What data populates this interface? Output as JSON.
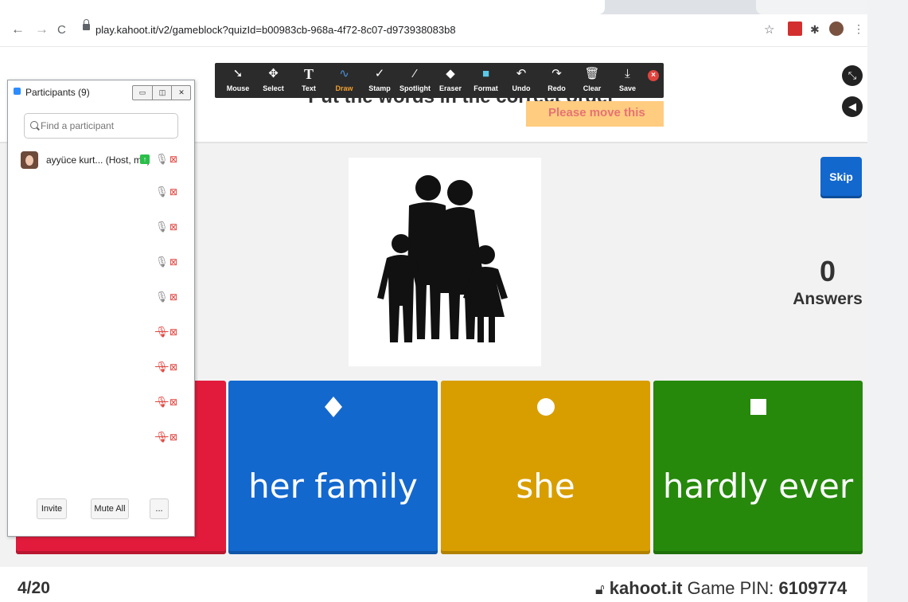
{
  "browser": {
    "url": "play.kahoot.it/v2/gameblock?quizId=b00983cb-968a-4f72-8c07-d973938083b8"
  },
  "annotation_toolbar": {
    "tools": [
      {
        "label": "Mouse",
        "icon": "cursor-arrow-icon"
      },
      {
        "label": "Select",
        "icon": "move-arrows-icon"
      },
      {
        "label": "Text",
        "icon": "text-t-icon"
      },
      {
        "label": "Draw",
        "icon": "squiggle-icon"
      },
      {
        "label": "Stamp",
        "icon": "checkmark-icon"
      },
      {
        "label": "Spotlight",
        "icon": "magic-wand-icon"
      },
      {
        "label": "Eraser",
        "icon": "eraser-icon"
      },
      {
        "label": "Format",
        "icon": "color-swatch-icon"
      },
      {
        "label": "Undo",
        "icon": "undo-icon"
      },
      {
        "label": "Redo",
        "icon": "redo-icon"
      },
      {
        "label": "Clear",
        "icon": "trash-icon"
      },
      {
        "label": "Save",
        "icon": "save-icon"
      }
    ],
    "active_tool": "Draw",
    "accent": "#f0a030"
  },
  "game": {
    "question": "Put the words in the correct order",
    "hint": "Please move this",
    "skip_label": "Skip",
    "answers_count": "0",
    "answers_label": "Answers",
    "image": "family-silhouette",
    "options": [
      {
        "shape": "triangle",
        "label": "",
        "color": "#e21b3c"
      },
      {
        "shape": "diamond",
        "label": "her family",
        "color": "#1368ce"
      },
      {
        "shape": "circle",
        "label": "she",
        "color": "#d89e00"
      },
      {
        "shape": "square",
        "label": "hardly ever",
        "color": "#26890c"
      }
    ],
    "progress": "4/20",
    "site": "kahoot.it",
    "pin_label": "Game PIN:",
    "pin": "6109774"
  },
  "participants": {
    "title": "Participants (9)",
    "search_placeholder": "Find a participant",
    "host_name": "ayyüce kurt... (Host, me)",
    "rows": [
      {
        "mic": "on",
        "video": "off"
      },
      {
        "mic": "on",
        "video": "off"
      },
      {
        "mic": "on",
        "video": "off"
      },
      {
        "mic": "on",
        "video": "off"
      },
      {
        "mic": "muted",
        "video": "off"
      },
      {
        "mic": "muted",
        "video": "off"
      },
      {
        "mic": "muted",
        "video": "off"
      },
      {
        "mic": "muted",
        "video": "off"
      }
    ],
    "invite_label": "Invite",
    "mute_all_label": "Mute All",
    "more_label": "..."
  }
}
